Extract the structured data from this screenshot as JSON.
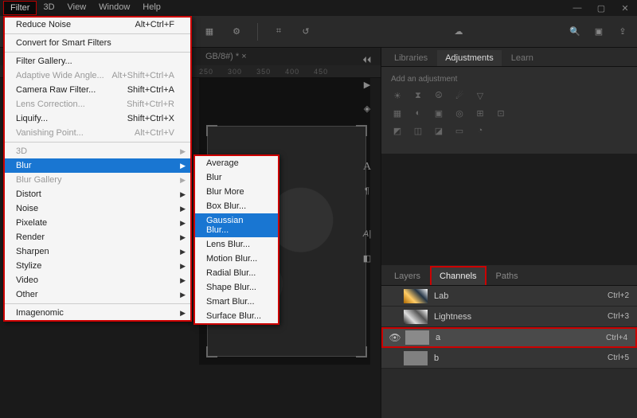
{
  "menubar": {
    "items": [
      "Filter",
      "3D",
      "View",
      "Window",
      "Help"
    ],
    "active": "Filter"
  },
  "toolbar_icons": [
    "presets-icon",
    "gear-icon",
    "crop-icon",
    "straighten-icon",
    "cloud-icon",
    "search-icon",
    "layout-icon",
    "share-icon"
  ],
  "doc_tab": "GB/8#) * ×",
  "ruler_marks": [
    "250",
    "300",
    "350",
    "400",
    "450"
  ],
  "filter_menu": {
    "sections": [
      [
        {
          "label": "Reduce Noise",
          "shortcut": "Alt+Ctrl+F",
          "arrow": false
        }
      ],
      [
        {
          "label": "Convert for Smart Filters",
          "arrow": false
        }
      ],
      [
        {
          "label": "Filter Gallery...",
          "arrow": false
        },
        {
          "label": "Adaptive Wide Angle...",
          "shortcut": "Alt+Shift+Ctrl+A",
          "disabled": true,
          "arrow": false
        },
        {
          "label": "Camera Raw Filter...",
          "shortcut": "Shift+Ctrl+A",
          "arrow": false
        },
        {
          "label": "Lens Correction...",
          "shortcut": "Shift+Ctrl+R",
          "disabled": true,
          "arrow": false
        },
        {
          "label": "Liquify...",
          "shortcut": "Shift+Ctrl+X",
          "arrow": false
        },
        {
          "label": "Vanishing Point...",
          "shortcut": "Alt+Ctrl+V",
          "disabled": true,
          "arrow": false
        }
      ],
      [
        {
          "label": "3D",
          "disabled": true,
          "arrow": true
        },
        {
          "label": "Blur",
          "highlight": true,
          "arrow": true
        },
        {
          "label": "Blur Gallery",
          "disabled": true,
          "arrow": true
        },
        {
          "label": "Distort",
          "arrow": true
        },
        {
          "label": "Noise",
          "arrow": true
        },
        {
          "label": "Pixelate",
          "arrow": true
        },
        {
          "label": "Render",
          "arrow": true
        },
        {
          "label": "Sharpen",
          "arrow": true
        },
        {
          "label": "Stylize",
          "arrow": true
        },
        {
          "label": "Video",
          "arrow": true
        },
        {
          "label": "Other",
          "arrow": true
        }
      ],
      [
        {
          "label": "Imagenomic",
          "arrow": true
        }
      ]
    ]
  },
  "blur_submenu": [
    {
      "label": "Average"
    },
    {
      "label": "Blur"
    },
    {
      "label": "Blur More"
    },
    {
      "label": "Box Blur..."
    },
    {
      "label": "Gaussian Blur...",
      "highlight": true
    },
    {
      "label": "Lens Blur..."
    },
    {
      "label": "Motion Blur..."
    },
    {
      "label": "Radial Blur..."
    },
    {
      "label": "Shape Blur..."
    },
    {
      "label": "Smart Blur..."
    },
    {
      "label": "Surface Blur..."
    }
  ],
  "right_panels": {
    "top_tabs": [
      "Libraries",
      "Adjustments",
      "Learn"
    ],
    "top_active": "Adjustments",
    "adj_title": "Add an adjustment",
    "layer_tabs": [
      "Layers",
      "Channels",
      "Paths"
    ],
    "layer_active": "Channels",
    "channels": [
      {
        "name": "Lab",
        "shortcut": "Ctrl+2",
        "thumb": "lab",
        "eye": false
      },
      {
        "name": "Lightness",
        "shortcut": "Ctrl+3",
        "thumb": "light",
        "eye": false
      },
      {
        "name": "a",
        "shortcut": "Ctrl+4",
        "thumb": "a",
        "eye": true,
        "selected": true
      },
      {
        "name": "b",
        "shortcut": "Ctrl+5",
        "thumb": "b",
        "eye": false
      }
    ]
  }
}
